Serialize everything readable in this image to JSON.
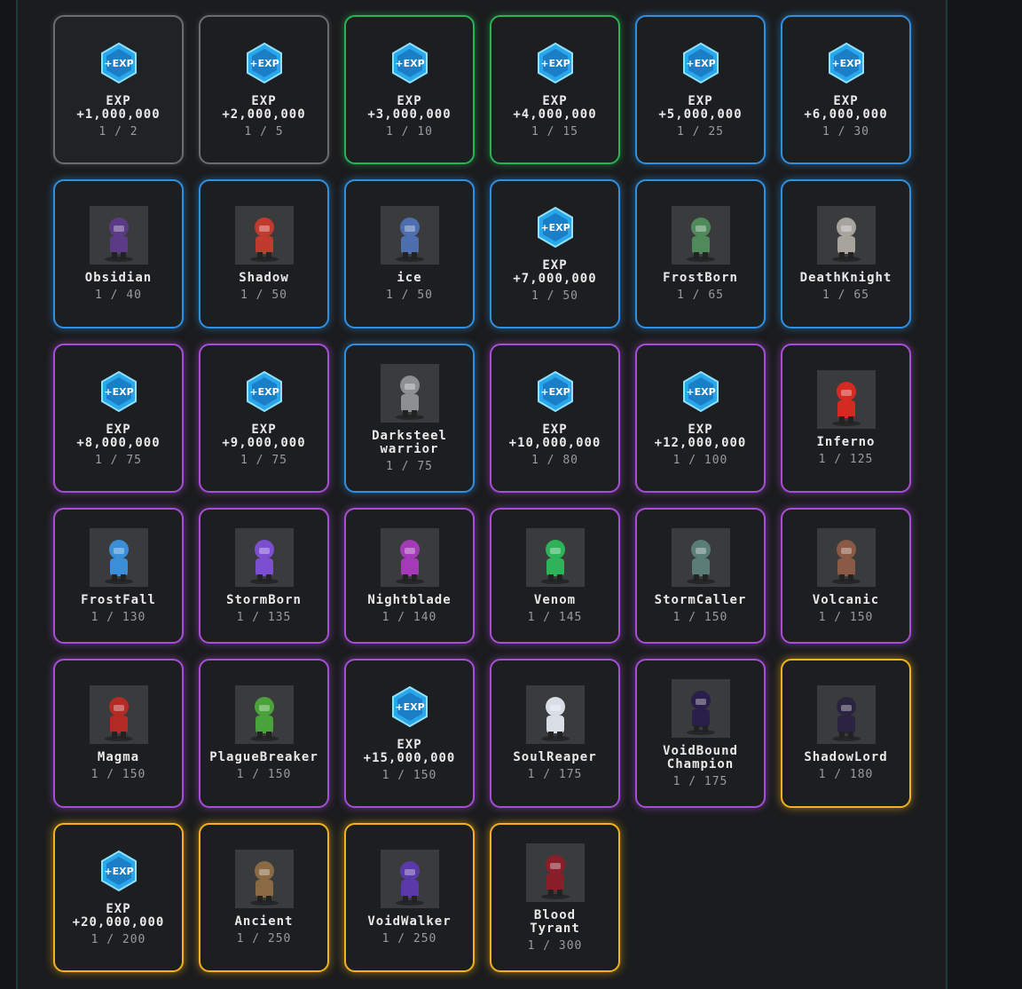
{
  "colors": {
    "common": "#6a6d70",
    "uncommon": "#27b455",
    "rare": "#2f8fe0",
    "epic": "#a64fd6",
    "legendary": "#f2b21c",
    "exp_icon": "#2aa7ea"
  },
  "rewards": [
    {
      "icon": "exp-icon",
      "title": [
        "EXP",
        "+1,000,000"
      ],
      "progress": "1 / 2",
      "rarity": "common"
    },
    {
      "icon": "exp-icon",
      "title": [
        "EXP",
        "+2,000,000"
      ],
      "progress": "1 / 5",
      "rarity": "common"
    },
    {
      "icon": "exp-icon",
      "title": [
        "EXP",
        "+3,000,000"
      ],
      "progress": "1 / 10",
      "rarity": "uncommon"
    },
    {
      "icon": "exp-icon",
      "title": [
        "EXP",
        "+4,000,000"
      ],
      "progress": "1 / 15",
      "rarity": "uncommon"
    },
    {
      "icon": "exp-icon",
      "title": [
        "EXP",
        "+5,000,000"
      ],
      "progress": "1 / 25",
      "rarity": "rare"
    },
    {
      "icon": "exp-icon",
      "title": [
        "EXP",
        "+6,000,000"
      ],
      "progress": "1 / 30",
      "rarity": "rare"
    },
    {
      "icon": "character-obsidian-icon",
      "title": [
        "Obsidian"
      ],
      "progress": "1 / 40",
      "rarity": "rare",
      "tint": "#5b3a86"
    },
    {
      "icon": "character-shadow-icon",
      "title": [
        "Shadow"
      ],
      "progress": "1 / 50",
      "rarity": "rare",
      "tint": "#c03a2e"
    },
    {
      "icon": "character-ice-icon",
      "title": [
        "ice"
      ],
      "progress": "1 / 50",
      "rarity": "rare",
      "tint": "#4d6fb0"
    },
    {
      "icon": "exp-icon",
      "title": [
        "EXP",
        "+7,000,000"
      ],
      "progress": "1 / 50",
      "rarity": "rare"
    },
    {
      "icon": "character-frostborn-icon",
      "title": [
        "FrostBorn"
      ],
      "progress": "1 / 65",
      "rarity": "rare",
      "tint": "#4f8a5a"
    },
    {
      "icon": "character-deathknight-icon",
      "title": [
        "DeathKnight"
      ],
      "progress": "1 / 65",
      "rarity": "rare",
      "tint": "#a7a49e"
    },
    {
      "icon": "exp-icon",
      "title": [
        "EXP",
        "+8,000,000"
      ],
      "progress": "1 / 75",
      "rarity": "epic"
    },
    {
      "icon": "exp-icon",
      "title": [
        "EXP",
        "+9,000,000"
      ],
      "progress": "1 / 75",
      "rarity": "epic"
    },
    {
      "icon": "character-darksteel-warrior-icon",
      "title": [
        "Darksteel",
        "warrior"
      ],
      "progress": "1 / 75",
      "rarity": "rare",
      "tint": "#8d8f93"
    },
    {
      "icon": "exp-icon",
      "title": [
        "EXP",
        "+10,000,000"
      ],
      "progress": "1 / 80",
      "rarity": "epic"
    },
    {
      "icon": "exp-icon",
      "title": [
        "EXP",
        "+12,000,000"
      ],
      "progress": "1 / 100",
      "rarity": "epic"
    },
    {
      "icon": "character-inferno-icon",
      "title": [
        "Inferno"
      ],
      "progress": "1 / 125",
      "rarity": "epic",
      "tint": "#d42a22"
    },
    {
      "icon": "character-frostfall-icon",
      "title": [
        "FrostFall"
      ],
      "progress": "1 / 130",
      "rarity": "epic",
      "tint": "#3b8fd8"
    },
    {
      "icon": "character-stormborn-icon",
      "title": [
        "StormBorn"
      ],
      "progress": "1 / 135",
      "rarity": "epic",
      "tint": "#7b4fd0"
    },
    {
      "icon": "character-nightblade-icon",
      "title": [
        "Nightblade"
      ],
      "progress": "1 / 140",
      "rarity": "epic",
      "tint": "#a43ab8"
    },
    {
      "icon": "character-venom-icon",
      "title": [
        "Venom"
      ],
      "progress": "1 / 145",
      "rarity": "epic",
      "tint": "#2fb35a"
    },
    {
      "icon": "character-stormcaller-icon",
      "title": [
        "StormCaller"
      ],
      "progress": "1 / 150",
      "rarity": "epic",
      "tint": "#5a7d78"
    },
    {
      "icon": "character-volcanic-icon",
      "title": [
        "Volcanic"
      ],
      "progress": "1 / 150",
      "rarity": "epic",
      "tint": "#8a5a46"
    },
    {
      "icon": "character-magma-icon",
      "title": [
        "Magma"
      ],
      "progress": "1 / 150",
      "rarity": "epic",
      "tint": "#b42a24"
    },
    {
      "icon": "character-plaguebreaker-icon",
      "title": [
        "PlagueBreaker"
      ],
      "progress": "1 / 150",
      "rarity": "epic",
      "tint": "#49a33a"
    },
    {
      "icon": "exp-icon",
      "title": [
        "EXP",
        "+15,000,000"
      ],
      "progress": "1 / 150",
      "rarity": "epic"
    },
    {
      "icon": "character-soulreaper-icon",
      "title": [
        "SoulReaper"
      ],
      "progress": "1 / 175",
      "rarity": "epic",
      "tint": "#d9dde6"
    },
    {
      "icon": "character-voidbound-champion-icon",
      "title": [
        "VoidBound",
        "Champion"
      ],
      "progress": "1 / 175",
      "rarity": "epic",
      "tint": "#2a1e4a"
    },
    {
      "icon": "character-shadowlord-icon",
      "title": [
        "ShadowLord"
      ],
      "progress": "1 / 180",
      "rarity": "legendary",
      "tint": "#2b2440"
    },
    {
      "icon": "exp-icon",
      "title": [
        "EXP",
        "+20,000,000"
      ],
      "progress": "1 / 200",
      "rarity": "legendary"
    },
    {
      "icon": "character-ancient-icon",
      "title": [
        "Ancient"
      ],
      "progress": "1 / 250",
      "rarity": "legendary",
      "tint": "#8a6a44"
    },
    {
      "icon": "character-voidwalker-icon",
      "title": [
        "VoidWalker"
      ],
      "progress": "1 / 250",
      "rarity": "legendary",
      "tint": "#5a3aa8"
    },
    {
      "icon": "character-blood-tyrant-icon",
      "title": [
        "Blood",
        "Tyrant"
      ],
      "progress": "1 / 300",
      "rarity": "legendary",
      "tint": "#8a1e2a"
    }
  ]
}
